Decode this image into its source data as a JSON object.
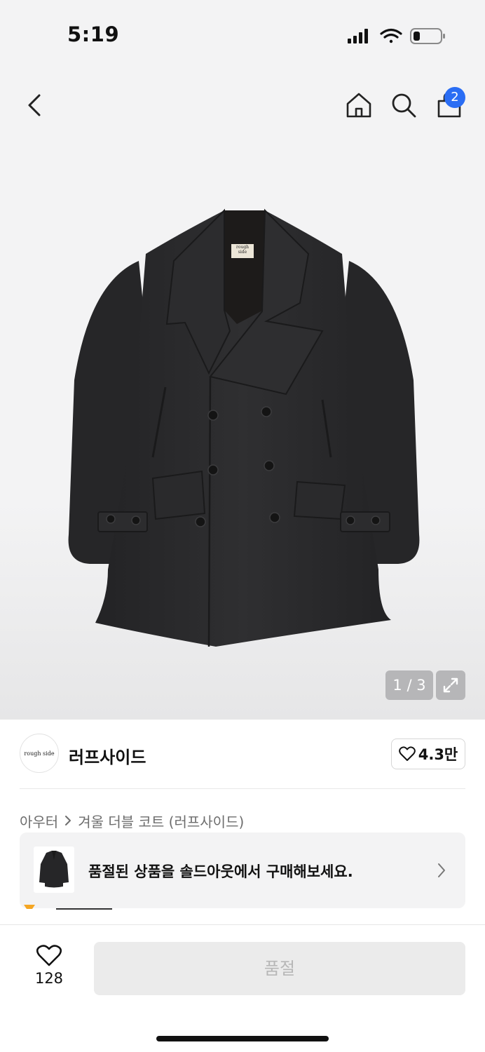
{
  "status_bar": {
    "time": "5:19"
  },
  "nav": {
    "cart_count": "2",
    "icons": [
      "back-chevron-icon",
      "home-icon",
      "search-icon",
      "shopping-bag-icon"
    ]
  },
  "product_image": {
    "label_text": "rough side",
    "page_counter": "1 / 3"
  },
  "brand": {
    "logo_text": "rough side",
    "name": "러프사이드",
    "likes": "4.3만"
  },
  "breadcrumb": {
    "category": "아우터",
    "product": "겨울 더블 코트 (러프사이드)"
  },
  "soldout_card": {
    "text": "품절된 상품을 솔드아웃에서 구매해보세요."
  },
  "bottom_bar": {
    "wish_count": "128",
    "buy_label": "품절"
  },
  "colors": {
    "accent_blue": "#2a6df4",
    "disabled_button": "#ebebeb",
    "coat": "#2b2b2d"
  }
}
